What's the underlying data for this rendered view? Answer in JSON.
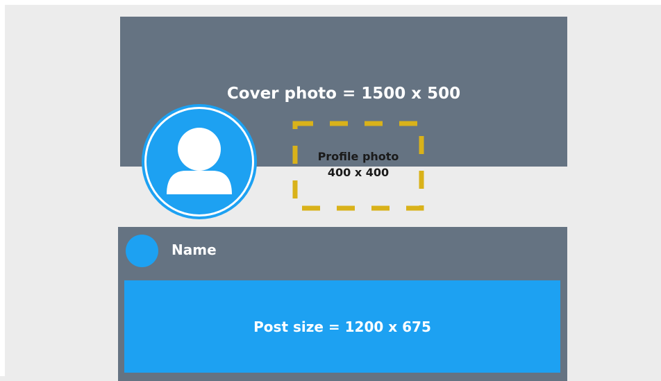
{
  "cover": {
    "label": "Cover photo = 1500 x 500"
  },
  "profile": {
    "label_line1": "Profile photo",
    "label_line2": "400 x 400",
    "icon": "user-avatar-icon"
  },
  "card": {
    "name": "Name",
    "post_label": "Post size = 1200 x 675"
  },
  "colors": {
    "slate": "#657382",
    "blue": "#1da1f2",
    "dash": "#d9b21a",
    "background": "#ececec"
  }
}
